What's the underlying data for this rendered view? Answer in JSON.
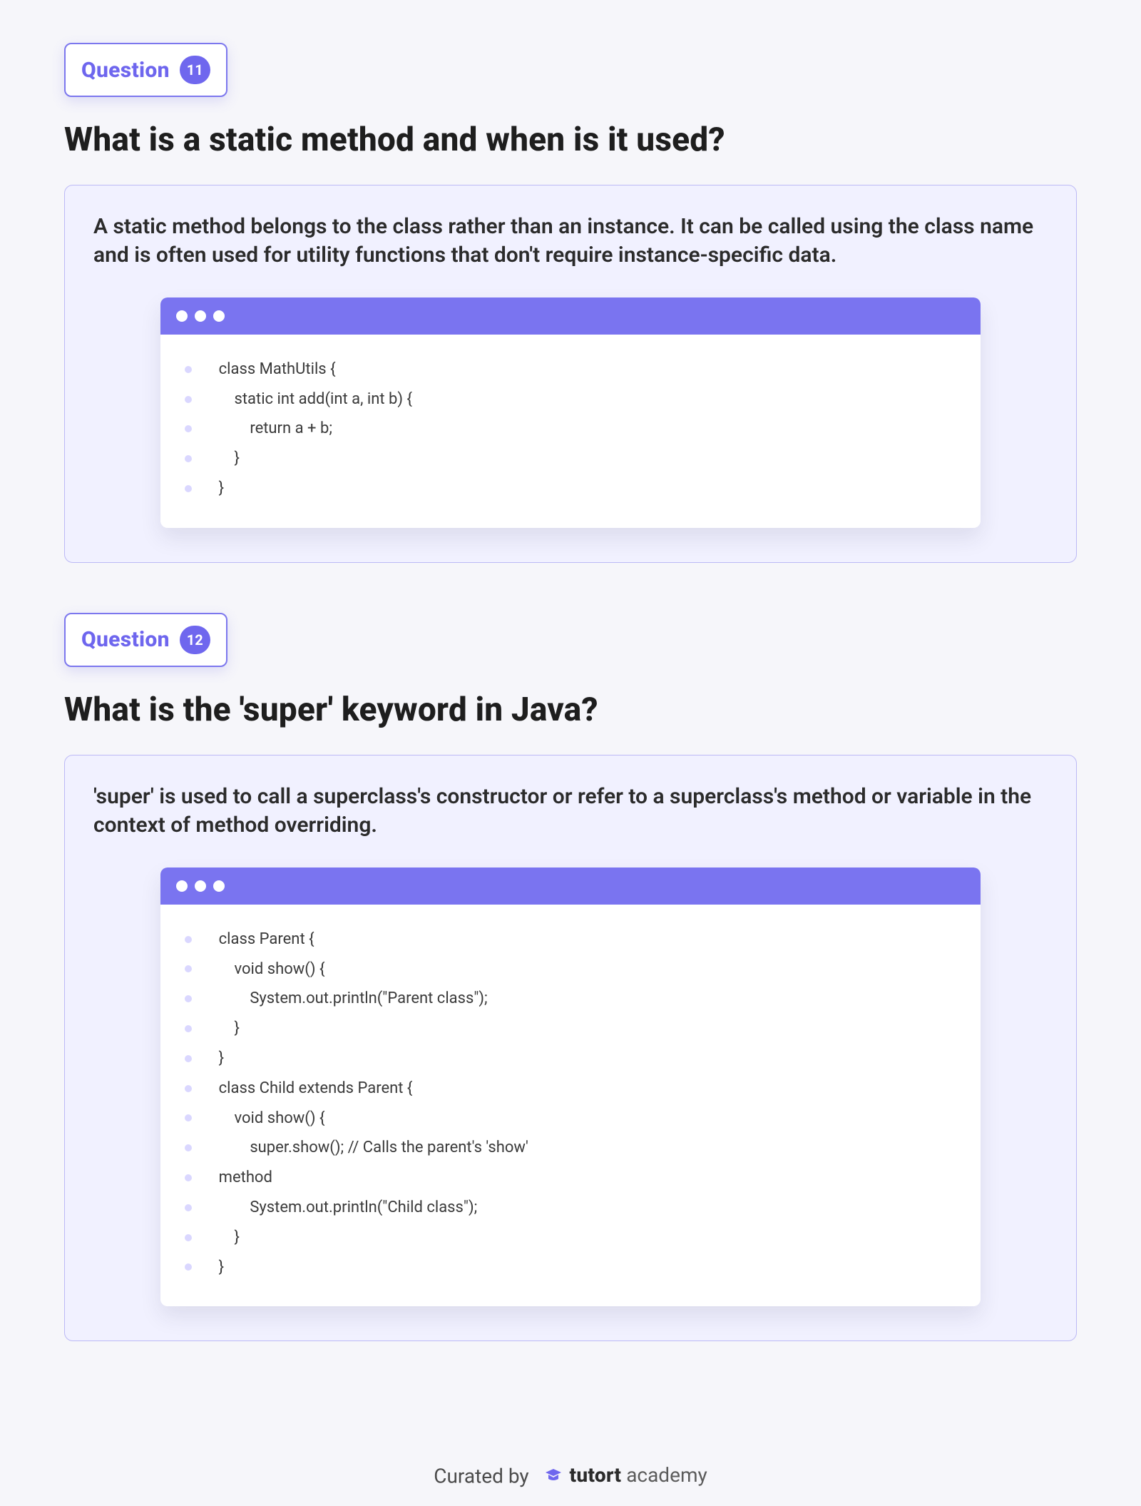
{
  "questions": [
    {
      "label": "Question",
      "number": "11",
      "title": "What is a static method and when is it used?",
      "answer": "A static method belongs to the class rather than an instance. It can be called using the class name and is often used for utility functions that don't require instance-specific data.",
      "code": [
        "class MathUtils {",
        "    static int add(int a, int b) {",
        "        return a + b;",
        "    }",
        "}"
      ]
    },
    {
      "label": "Question",
      "number": "12",
      "title": "What is the 'super' keyword in Java?",
      "answer": "'super' is used to call a superclass's constructor or refer to a superclass's method or variable in the context of method overriding.",
      "code": [
        "class Parent {",
        "    void show() {",
        "        System.out.println(\"Parent class\");",
        "    }",
        "}",
        "class Child extends Parent {",
        "    void show() {",
        "        super.show(); // Calls the parent's 'show'",
        "method",
        "        System.out.println(\"Child class\");",
        "    }",
        "}"
      ]
    }
  ],
  "footer": {
    "curated": "Curated by",
    "brand_strong": "tutort",
    "brand_light": "academy"
  },
  "colors": {
    "accent": "#6f67ee",
    "panel": "#f1f1ff",
    "border": "#bcb9f5"
  }
}
